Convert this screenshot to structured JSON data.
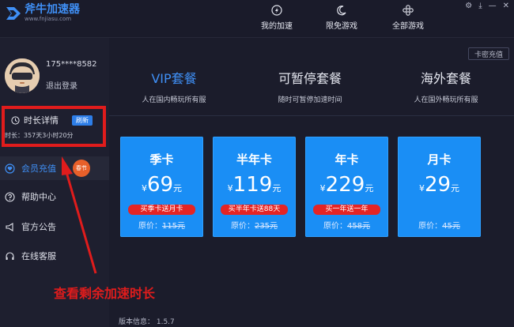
{
  "app": {
    "title": "斧牛加速器",
    "url": "www.fnjiasu.com"
  },
  "nav": [
    {
      "label": "我的加速",
      "icon": "lightning-icon"
    },
    {
      "label": "限免游戏",
      "icon": "moon-icon"
    },
    {
      "label": "全部游戏",
      "icon": "grid-icon"
    }
  ],
  "window_icons": [
    "gear-icon",
    "download-icon",
    "minimize-icon",
    "close-icon"
  ],
  "user": {
    "id": "175****8582",
    "logout": "退出登录"
  },
  "duration": {
    "label": "时长详情",
    "refresh": "刷新",
    "value": "时长：357天3小时20分"
  },
  "menu": [
    {
      "label": "会员充值",
      "icon": "heart-shield-icon",
      "active": true,
      "badge": "春节"
    },
    {
      "label": "帮助中心",
      "icon": "help-icon",
      "active": false
    },
    {
      "label": "官方公告",
      "icon": "megaphone-icon",
      "active": false
    },
    {
      "label": "在线客服",
      "icon": "headset-icon",
      "active": false
    }
  ],
  "recharge_card": "卡密充值",
  "tabs": [
    {
      "title": "VIP套餐",
      "sub": "人在国内畅玩所有服",
      "active": true
    },
    {
      "title": "可暂停套餐",
      "sub": "随时可暂停加速时间",
      "active": false
    },
    {
      "title": "海外套餐",
      "sub": "人在国外畅玩所有服",
      "active": false
    }
  ],
  "cards": [
    {
      "name": "季卡",
      "yen": "¥",
      "price": "69",
      "unit": "元",
      "promo": "买季卡送月卡",
      "orig_label": "原价：",
      "orig_value": "115元"
    },
    {
      "name": "半年卡",
      "yen": "¥",
      "price": "119",
      "unit": "元",
      "promo": "买半年卡送88天",
      "orig_label": "原价：",
      "orig_value": "235元"
    },
    {
      "name": "年卡",
      "yen": "¥",
      "price": "229",
      "unit": "元",
      "promo": "买一年送一年",
      "orig_label": "原价：",
      "orig_value": "458元"
    },
    {
      "name": "月卡",
      "yen": "¥",
      "price": "29",
      "unit": "元",
      "promo": "",
      "orig_label": "原价：",
      "orig_value": "45元"
    }
  ],
  "version": "版本信息： 1.5.7",
  "annotation": "查看剩余加速时长",
  "colors": {
    "accent": "#3f8ff5",
    "card": "#1a8ef5",
    "promo": "#e52424",
    "annotation": "#e01c1c",
    "background": "#1b1c2b"
  }
}
